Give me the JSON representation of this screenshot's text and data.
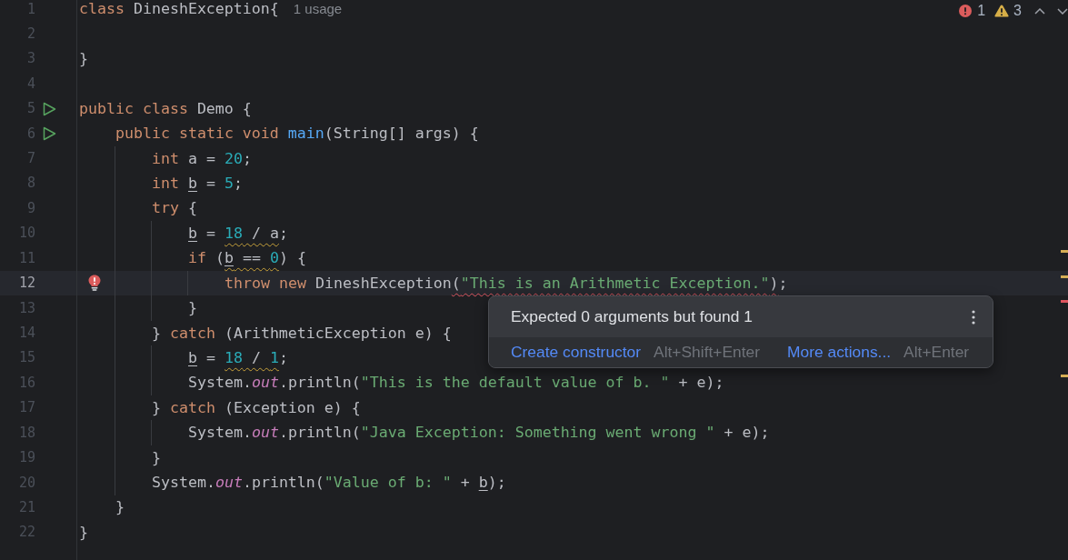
{
  "inspections": {
    "errors": "1",
    "warnings": "3"
  },
  "editor": {
    "lines": [
      {
        "number": "1",
        "current": false,
        "runnable": false,
        "has_error": false,
        "tokens": [
          {
            "kind": "keyword",
            "text": "class"
          },
          {
            "kind": "text",
            "text": " DineshException{"
          }
        ],
        "hint": "1 usage"
      },
      {
        "number": "2",
        "current": false,
        "runnable": false,
        "has_error": false
      },
      {
        "number": "3",
        "current": false,
        "runnable": false,
        "has_error": false,
        "tokens": [
          {
            "kind": "text",
            "text": "}"
          }
        ]
      },
      {
        "number": "4",
        "current": false,
        "runnable": false,
        "has_error": false
      },
      {
        "number": "5",
        "current": false,
        "runnable": true,
        "has_error": false,
        "tokens": [
          {
            "kind": "keyword",
            "text": "public class"
          },
          {
            "kind": "text",
            "text": " Demo {"
          }
        ],
        "children": [
          {
            "number": "6",
            "current": false,
            "runnable": true,
            "has_error": false,
            "tokens": [
              {
                "kind": "keyword",
                "text": "public static void"
              },
              {
                "kind": "method",
                "text": " main"
              },
              {
                "kind": "text",
                "text": "(String[] args) {"
              }
            ],
            "children": [
              {
                "number": "7",
                "current": false,
                "runnable": false,
                "has_error": false,
                "tokens": [
                  {
                    "kind": "keyword",
                    "text": "int"
                  },
                  {
                    "kind": "text",
                    "text": " a = "
                  },
                  {
                    "kind": "number",
                    "text": "20"
                  },
                  {
                    "kind": "text",
                    "text": ";"
                  }
                ]
              },
              {
                "number": "8",
                "current": false,
                "runnable": false,
                "has_error": false,
                "tokens": [
                  {
                    "kind": "keyword",
                    "text": "int "
                  },
                  {
                    "kind": "reassigned_var",
                    "text": "b"
                  },
                  {
                    "kind": "text",
                    "text": " = "
                  },
                  {
                    "kind": "number",
                    "text": "5"
                  },
                  {
                    "kind": "text",
                    "text": ";"
                  }
                ]
              },
              {
                "number": "9",
                "current": false,
                "runnable": false,
                "has_error": false,
                "tokens": [
                  {
                    "kind": "keyword",
                    "text": "try"
                  },
                  {
                    "kind": "text",
                    "text": " {"
                  }
                ],
                "children": [
                  {
                    "number": "10",
                    "current": false,
                    "runnable": false,
                    "has_error": false,
                    "tokens": [
                      {
                        "kind": "reassigned_var",
                        "text": "b"
                      },
                      {
                        "kind": "text",
                        "text": " = "
                      },
                      {
                        "kind": "warning",
                        "tokens": [
                          {
                            "kind": "number",
                            "text": "18"
                          },
                          {
                            "kind": "text",
                            "text": " / a"
                          }
                        ]
                      },
                      {
                        "kind": "text",
                        "text": ";"
                      }
                    ]
                  },
                  {
                    "number": "11",
                    "current": false,
                    "runnable": false,
                    "has_error": false,
                    "tokens": [
                      {
                        "kind": "keyword",
                        "text": "if"
                      },
                      {
                        "kind": "text",
                        "text": " ("
                      },
                      {
                        "kind": "warning",
                        "tokens": [
                          {
                            "kind": "reassigned_var",
                            "text": "b"
                          },
                          {
                            "kind": "text",
                            "text": " == "
                          },
                          {
                            "kind": "number",
                            "text": "0"
                          }
                        ]
                      },
                      {
                        "kind": "text",
                        "text": ") {"
                      }
                    ],
                    "children": [
                      {
                        "number": "12",
                        "current": true,
                        "runnable": false,
                        "has_error": true,
                        "tokens": [
                          {
                            "kind": "keyword",
                            "text": "throw new"
                          },
                          {
                            "kind": "text",
                            "text": " DineshException"
                          },
                          {
                            "kind": "error",
                            "tokens": [
                              {
                                "kind": "text",
                                "text": "("
                              },
                              {
                                "kind": "string",
                                "text": "\"This is an Arithmetic Exception.\""
                              },
                              {
                                "kind": "text",
                                "text": ")"
                              }
                            ]
                          },
                          {
                            "kind": "text",
                            "text": ";"
                          }
                        ]
                      }
                    ]
                  },
                  {
                    "number": "13",
                    "current": false,
                    "runnable": false,
                    "has_error": false,
                    "tokens": [
                      {
                        "kind": "text",
                        "text": "}"
                      }
                    ]
                  }
                ]
              },
              {
                "number": "14",
                "current": false,
                "runnable": false,
                "has_error": false,
                "tokens": [
                  {
                    "kind": "text",
                    "text": "} "
                  },
                  {
                    "kind": "keyword",
                    "text": "catch"
                  },
                  {
                    "kind": "text",
                    "text": " (ArithmeticException e) {"
                  }
                ],
                "children": [
                  {
                    "number": "15",
                    "current": false,
                    "runnable": false,
                    "has_error": false,
                    "tokens": [
                      {
                        "kind": "reassigned_var",
                        "text": "b"
                      },
                      {
                        "kind": "text",
                        "text": " = "
                      },
                      {
                        "kind": "warning",
                        "tokens": [
                          {
                            "kind": "number",
                            "text": "18"
                          },
                          {
                            "kind": "text",
                            "text": " / "
                          },
                          {
                            "kind": "number",
                            "text": "1"
                          }
                        ]
                      },
                      {
                        "kind": "text",
                        "text": ";"
                      }
                    ]
                  },
                  {
                    "number": "16",
                    "current": false,
                    "runnable": false,
                    "has_error": false,
                    "tokens": [
                      {
                        "kind": "text",
                        "text": "System."
                      },
                      {
                        "kind": "static_field",
                        "text": "out"
                      },
                      {
                        "kind": "text",
                        "text": ".println("
                      },
                      {
                        "kind": "string",
                        "text": "\"This is the default value of b. \""
                      },
                      {
                        "kind": "text",
                        "text": " + e);"
                      }
                    ]
                  }
                ]
              },
              {
                "number": "17",
                "current": false,
                "runnable": false,
                "has_error": false,
                "tokens": [
                  {
                    "kind": "text",
                    "text": "} "
                  },
                  {
                    "kind": "keyword",
                    "text": "catch"
                  },
                  {
                    "kind": "text",
                    "text": " (Exception e) {"
                  }
                ],
                "children": [
                  {
                    "number": "18",
                    "current": false,
                    "runnable": false,
                    "has_error": false,
                    "tokens": [
                      {
                        "kind": "text",
                        "text": "System."
                      },
                      {
                        "kind": "static_field",
                        "text": "out"
                      },
                      {
                        "kind": "text",
                        "text": ".println("
                      },
                      {
                        "kind": "string",
                        "text": "\"Java Exception: Something went wrong \""
                      },
                      {
                        "kind": "text",
                        "text": " + e);"
                      }
                    ]
                  }
                ]
              },
              {
                "number": "19",
                "current": false,
                "runnable": false,
                "has_error": false,
                "tokens": [
                  {
                    "kind": "text",
                    "text": "}"
                  }
                ]
              },
              {
                "number": "20",
                "current": false,
                "runnable": false,
                "has_error": false,
                "tokens": [
                  {
                    "kind": "text",
                    "text": "System."
                  },
                  {
                    "kind": "static_field",
                    "text": "out"
                  },
                  {
                    "kind": "text",
                    "text": ".println("
                  },
                  {
                    "kind": "string",
                    "text": "\"Value of b: \""
                  },
                  {
                    "kind": "text",
                    "text": " + "
                  },
                  {
                    "kind": "reassigned_var",
                    "text": "b"
                  },
                  {
                    "kind": "text",
                    "text": ");"
                  }
                ]
              }
            ]
          },
          {
            "number": "21",
            "current": false,
            "runnable": false,
            "has_error": false,
            "tokens": [
              {
                "kind": "text",
                "text": "}"
              }
            ]
          }
        ]
      },
      {
        "number": "22",
        "current": false,
        "runnable": false,
        "has_error": false,
        "tokens": [
          {
            "kind": "text",
            "text": "}"
          }
        ]
      }
    ]
  },
  "popup": {
    "message": "Expected 0 arguments but found 1",
    "actions": [
      {
        "label": "Create constructor",
        "shortcut": "Alt+Shift+Enter"
      },
      {
        "label": "More actions...",
        "shortcut": "Alt+Enter"
      }
    ]
  }
}
